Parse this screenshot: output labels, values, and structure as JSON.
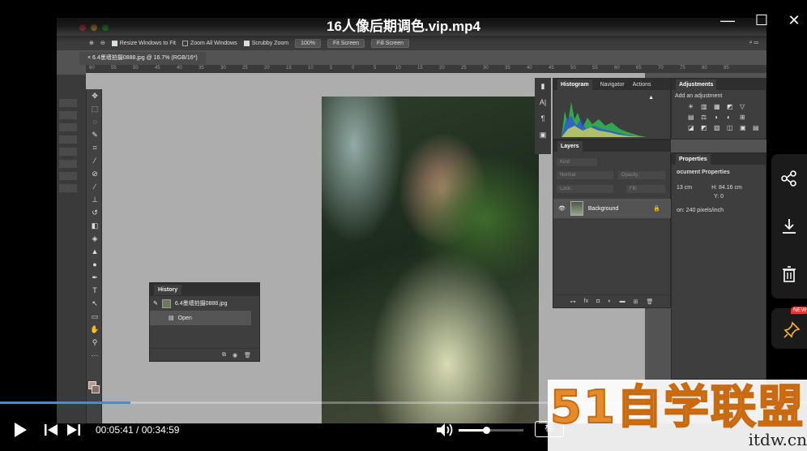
{
  "player": {
    "title": "16人像后期调色.vip.mp4",
    "time_current": "00:05:41",
    "time_separator": " / ",
    "time_total": "00:34:59",
    "progress": 0.162,
    "volume": 0.42,
    "rate_label": "标",
    "accent_color": "#3b8de8"
  },
  "photoshop": {
    "options": {
      "zoom_percent": "100%",
      "resize_label": "Resize Windows to Fit",
      "zoom_all_label": "Zoom All Windows",
      "scrubby_label": "Scrubby Zoom",
      "fit_screen": "Fit Screen",
      "fill_screen": "Fill Screen"
    },
    "doc_tab": "6.4墨墙拍摄0888.jpg @ 16.7% (RGB/16*)",
    "ruler_ticks": [
      "60",
      "55",
      "50",
      "45",
      "40",
      "35",
      "30",
      "25",
      "20",
      "15",
      "10",
      "5",
      "0",
      "5",
      "10",
      "15",
      "20",
      "25",
      "30",
      "35",
      "40",
      "45",
      "50",
      "55",
      "60",
      "65",
      "70",
      "75",
      "80",
      "85"
    ],
    "history": {
      "tab": "History",
      "snapshot": "6.4墨墙拍摄0888.jpg",
      "step": "Open"
    },
    "histogram_tabs": [
      "Histogram",
      "Navigator",
      "Actions"
    ],
    "adjustments": {
      "title": "Adjustments",
      "subtitle": "Add an adjustment"
    },
    "layers": {
      "tab": "Layers",
      "kind": "Kind",
      "blend": "Normal",
      "opacity_label": "Opacity:",
      "lock_label": "Lock:",
      "fill_label": "Fill:",
      "layer_name": "Background"
    },
    "properties": {
      "tab": "Properties",
      "title": "ocument Properties",
      "w_value": "13 cm",
      "h_label": "H: 84.16 cm",
      "y_label": "Y: 0",
      "resolution": "on: 240 pixels/inch"
    }
  },
  "sidebar": {
    "new_badge": "NEW"
  },
  "watermark": {
    "brand": "51自学联盟",
    "url": "itdw.cn"
  }
}
